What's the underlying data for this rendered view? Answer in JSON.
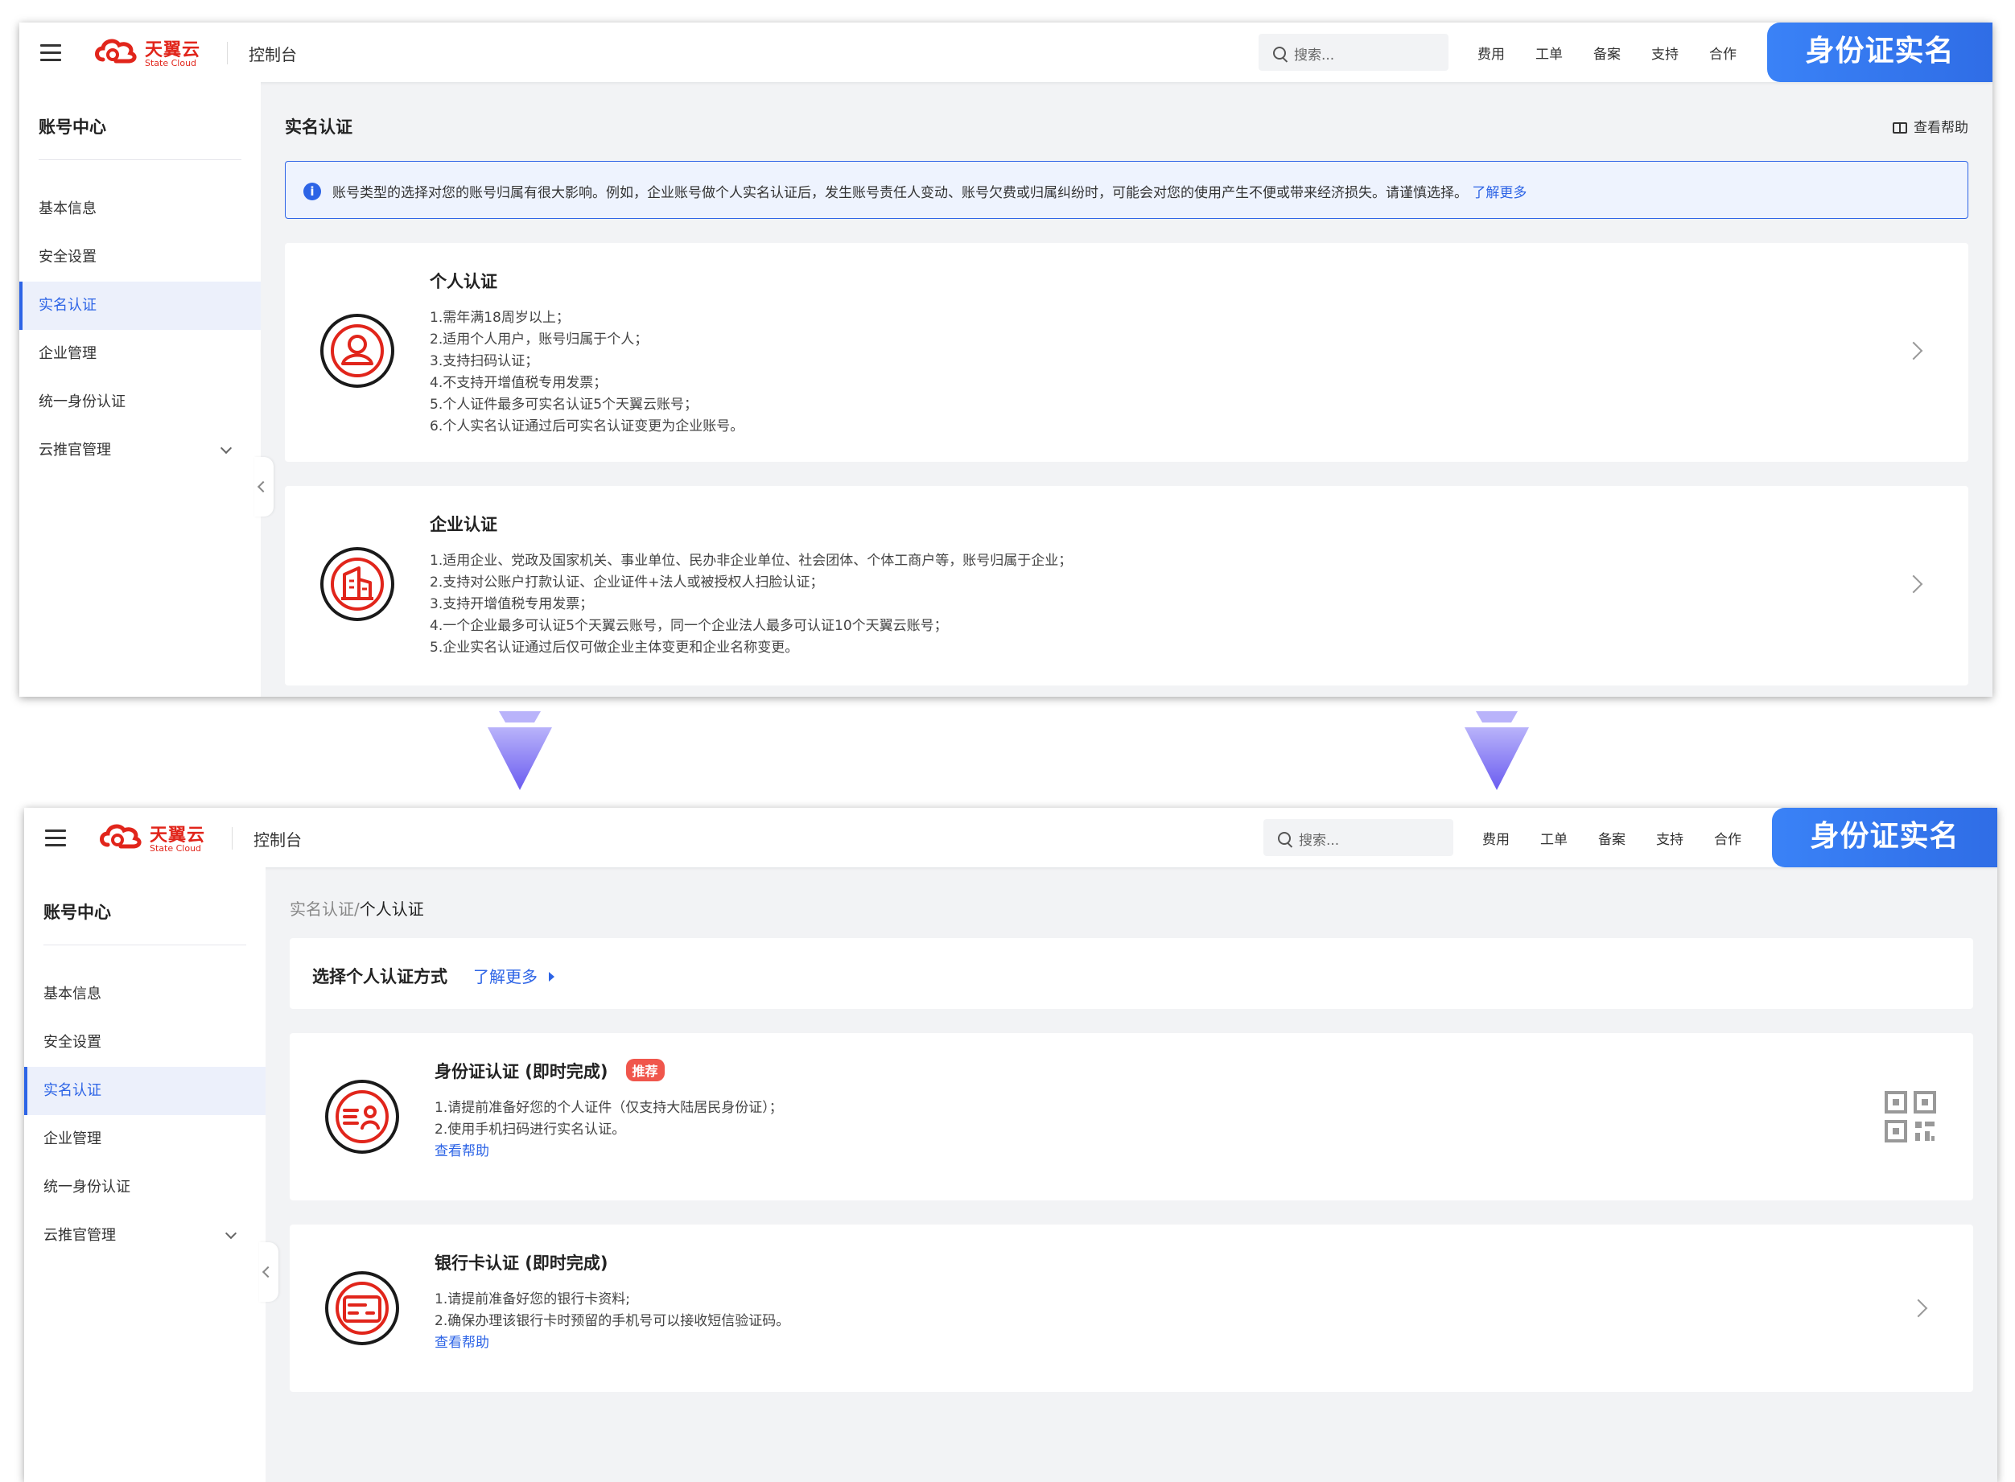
{
  "header": {
    "logo_cn": "天翼云",
    "logo_en": "State Cloud",
    "console": "控制台",
    "search_placeholder": "搜索...",
    "nav": [
      "费用",
      "工单",
      "备案",
      "支持",
      "合作"
    ],
    "banner": "身份证实名"
  },
  "sidebar": {
    "title": "账号中心",
    "items": [
      {
        "label": "基本信息"
      },
      {
        "label": "安全设置"
      },
      {
        "label": "实名认证",
        "active": true
      },
      {
        "label": "企业管理"
      },
      {
        "label": "统一身份认证"
      },
      {
        "label": "云推官管理",
        "expandable": true
      }
    ]
  },
  "screen1": {
    "title": "实名认证",
    "help": "查看帮助",
    "notice": "账号类型的选择对您的账号归属有很大影响。例如，企业账号做个人实名认证后，发生账号责任人变动、账号欠费或归属纠纷时，可能会对您的使用产生不便或带来经济损失。请谨慎选择。",
    "notice_link": "了解更多",
    "cards": [
      {
        "title": "个人认证",
        "lines": [
          "1.需年满18周岁以上；",
          "2.适用个人用户，账号归属于个人；",
          "3.支持扫码认证；",
          "4.不支持开增值税专用发票；",
          "5.个人证件最多可实名认证5个天翼云账号；",
          "6.个人实名认证通过后可实名认证变更为企业账号。"
        ]
      },
      {
        "title": "企业认证",
        "lines": [
          "1.适用企业、党政及国家机关、事业单位、民办非企业单位、社会团体、个体工商户等，账号归属于企业；",
          "2.支持对公账户打款认证、企业证件+法人或被授权人扫脸认证；",
          "3.支持开增值税专用发票；",
          "4.一个企业最多可认证5个天翼云账号，同一个企业法人最多可认证10个天翼云账号；",
          "5.企业实名认证通过后仅可做企业主体变更和企业名称变更。"
        ]
      }
    ]
  },
  "screen2": {
    "breadcrumb_link": "实名认证",
    "breadcrumb_sep": "/",
    "breadcrumb_current": "个人认证",
    "method_title": "选择个人认证方式",
    "method_more": "了解更多",
    "cards": [
      {
        "title": "身份证认证 (即时完成)",
        "badge": "推荐",
        "lines": [
          "1.请提前准备好您的个人证件（仅支持大陆居民身份证）；",
          "2.使用手机扫码进行实名认证。"
        ],
        "help": "查看帮助"
      },
      {
        "title": "银行卡认证 (即时完成)",
        "lines": [
          "1.请提前准备好您的银行卡资料;",
          "2.确保办理该银行卡时预留的手机号可以接收短信验证码。"
        ],
        "help": "查看帮助"
      }
    ]
  },
  "colors": {
    "primary": "#2d64e6",
    "brand_red": "#e1251b",
    "arrow": "#6b5cf0"
  }
}
